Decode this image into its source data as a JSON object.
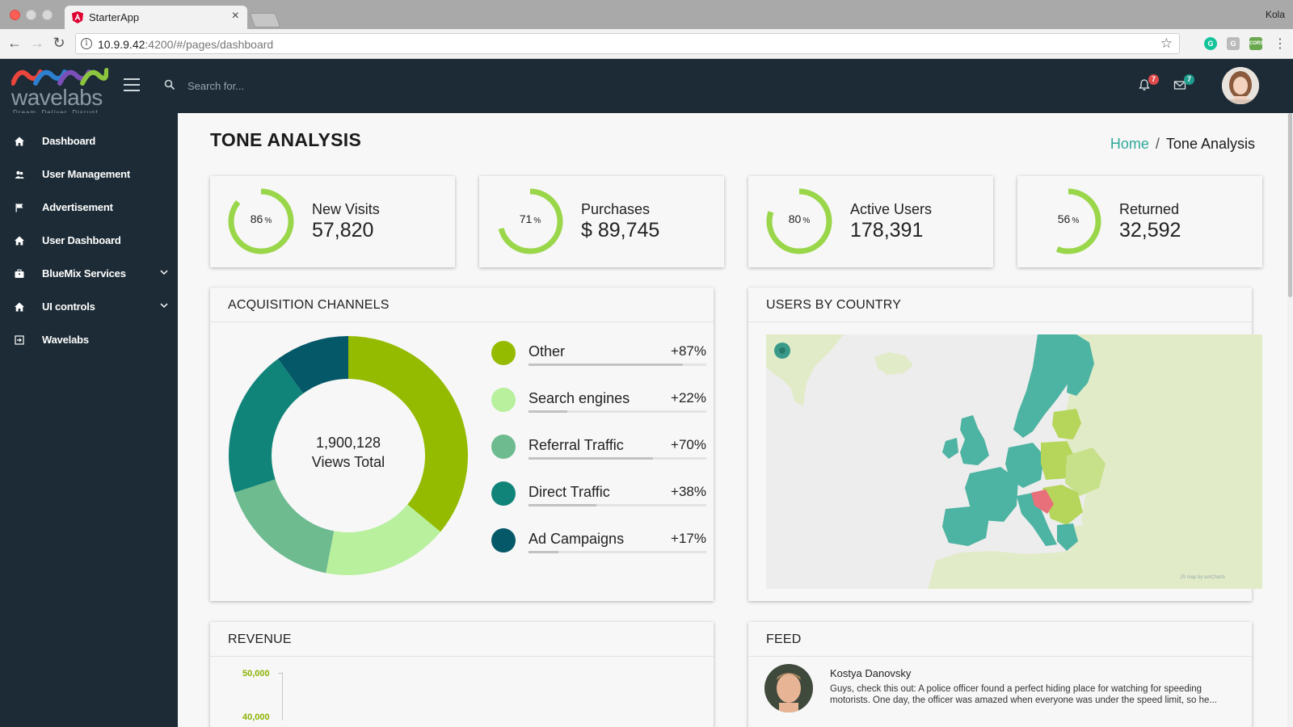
{
  "browser": {
    "tab_title": "StarterApp",
    "tab_close": "×",
    "profile_name": "Kola",
    "url_host": "10.9.9.42",
    "url_path": ":4200/#/pages/dashboard",
    "star": "☆",
    "menu": "⋮",
    "ext_g": "G",
    "ext_c": "G",
    "ext_cors": "CORS"
  },
  "header": {
    "logo_word": "wavelabs",
    "logo_tagline": "Dream.   Deliver.   Disrupt.",
    "search_placeholder": "Search for...",
    "notifications_count": "7",
    "messages_count": "7"
  },
  "sidebar": {
    "items": [
      {
        "label": "Dashboard",
        "icon": "home-icon"
      },
      {
        "label": "User Management",
        "icon": "users-icon"
      },
      {
        "label": "Advertisement",
        "icon": "flag-icon"
      },
      {
        "label": "User Dashboard",
        "icon": "home-icon"
      },
      {
        "label": "BlueMix Services",
        "icon": "briefcase-icon",
        "expandable": true
      },
      {
        "label": "UI controls",
        "icon": "home-icon",
        "expandable": true
      },
      {
        "label": "Wavelabs",
        "icon": "sign-in-icon"
      }
    ]
  },
  "page": {
    "title": "TONE ANALYSIS",
    "breadcrumb": {
      "home": "Home",
      "separator": "/",
      "current": "Tone Analysis"
    }
  },
  "stats": [
    {
      "label": "New Visits",
      "value": "57,820",
      "percent": 86,
      "percent_text": "86"
    },
    {
      "label": "Purchases",
      "value": "$ 89,745",
      "percent": 71,
      "percent_text": "71"
    },
    {
      "label": "Active Users",
      "value": "178,391",
      "percent": 80,
      "percent_text": "80"
    },
    {
      "label": "Returned",
      "value": "32,592",
      "percent": 56,
      "percent_text": "56"
    }
  ],
  "percent_symbol": "%",
  "acquisition": {
    "title": "ACQUISITION CHANNELS",
    "total_value": "1,900,128",
    "total_label": "Views Total",
    "channels": [
      {
        "name": "Other",
        "change": "+87%",
        "color": "#95bb00",
        "share": 87
      },
      {
        "name": "Search engines",
        "change": "+22%",
        "color": "#b8f09e",
        "share": 22
      },
      {
        "name": "Referral Traffic",
        "change": "+70%",
        "color": "#6dbb8f",
        "share": 70
      },
      {
        "name": "Direct Traffic",
        "change": "+38%",
        "color": "#118479",
        "share": 38
      },
      {
        "name": "Ad Campaigns",
        "change": "+17%",
        "color": "#045868",
        "share": 17
      }
    ]
  },
  "chart_data": {
    "type": "pie",
    "title": "ACQUISITION CHANNELS",
    "categories": [
      "Other",
      "Search engines",
      "Referral Traffic",
      "Direct Traffic",
      "Ad Campaigns"
    ],
    "values": [
      36,
      17,
      17,
      20,
      10
    ]
  },
  "map": {
    "title": "USERS BY COUNTRY",
    "credit": "JS map by amCharts"
  },
  "revenue": {
    "title": "REVENUE",
    "ticks": [
      "50,000",
      "40,000"
    ]
  },
  "feed": {
    "title": "FEED",
    "author": "Kostya Danovsky",
    "text": "Guys, check this out: A police officer found a perfect hiding place for watching for speeding motorists. One day, the officer was amazed when everyone was under the speed limit, so he..."
  },
  "colors": {
    "sidebar_bg": "#1c2b36",
    "ring_green": "#9ad64a",
    "accent_teal": "#2fa89a"
  }
}
